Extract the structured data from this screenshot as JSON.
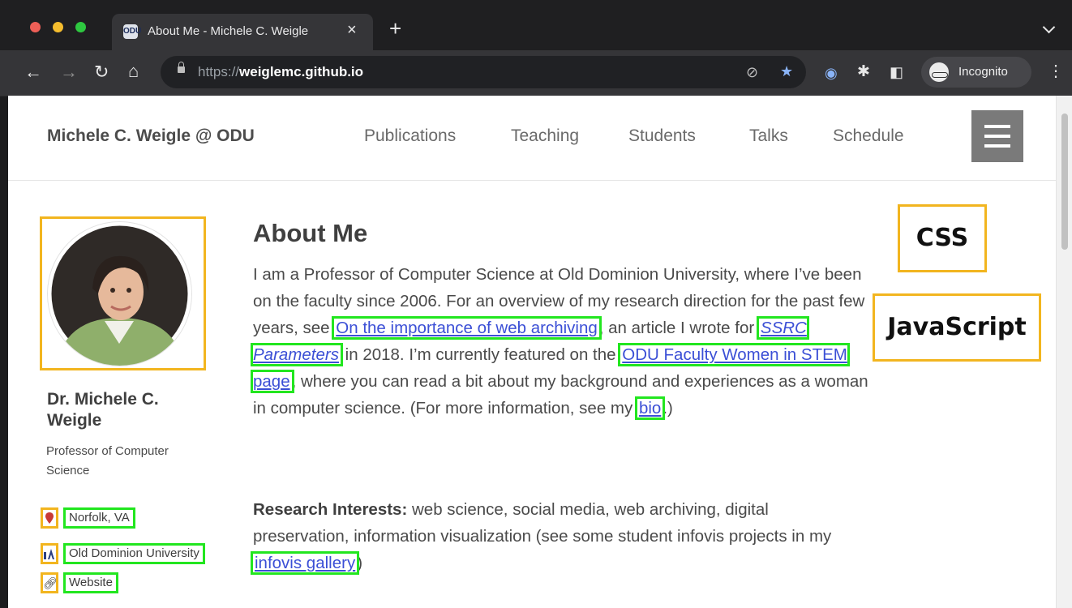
{
  "browser": {
    "tab_title": "About Me - Michele C. Weigle",
    "tab_favicon": "ODU",
    "url_prefix": "https://",
    "url_host": "weiglemc.github.io",
    "incognito_label": "Incognito",
    "icons": [
      "back-icon",
      "forward-icon",
      "reload-icon",
      "home-icon",
      "lock-icon",
      "eye-off-icon",
      "star-icon",
      "extension-icon",
      "puzzle-icon",
      "sidepanel-icon",
      "incognito-icon",
      "kebab-menu-icon"
    ]
  },
  "site": {
    "title": "Michele C. Weigle @ ODU",
    "nav": [
      "Publications",
      "Teaching",
      "Students",
      "Talks",
      "Schedule"
    ]
  },
  "sidebar": {
    "name": "Dr. Michele C. Weigle",
    "bio": "Professor of Computer Science",
    "items": [
      {
        "icon": "map-pin-icon",
        "label": "Norfolk, VA"
      },
      {
        "icon": "university-icon",
        "label": "Old Dominion University"
      },
      {
        "icon": "link-icon",
        "label": "Website"
      }
    ]
  },
  "main": {
    "title": "About Me",
    "p1_a": "I am a Professor of Computer Science at Old Dominion University, where I’ve been on the faculty since 2006. For an overview of my research direction for the past few years, see",
    "p1_link1": "On the importance of web archiving",
    "p1_b": ", an article I wrote for",
    "p1_link2": "SSRC Parameters",
    "p1_c": "in 2018. I’m currently featured on the",
    "p1_link3": "ODU Faculty Women in STEM page",
    "p1_d": ", where you can read a bit about my background and experiences as a woman in computer science. (For more information, see my",
    "p1_link4": "bio",
    "p1_e": ".)",
    "p2_label": "Research Interests:",
    "p2_a": "web science, social media, web archiving, digital preservation, information visualization (see some student infovis projects in my",
    "p2_link": "infovis gallery",
    "p2_b": ")"
  },
  "annotations": {
    "css": "CSS",
    "javascript": "JavaScript"
  },
  "colors": {
    "annotation_orange": "#f2b51f",
    "annotation_green": "#22e61f",
    "link": "#3b4fd6"
  }
}
